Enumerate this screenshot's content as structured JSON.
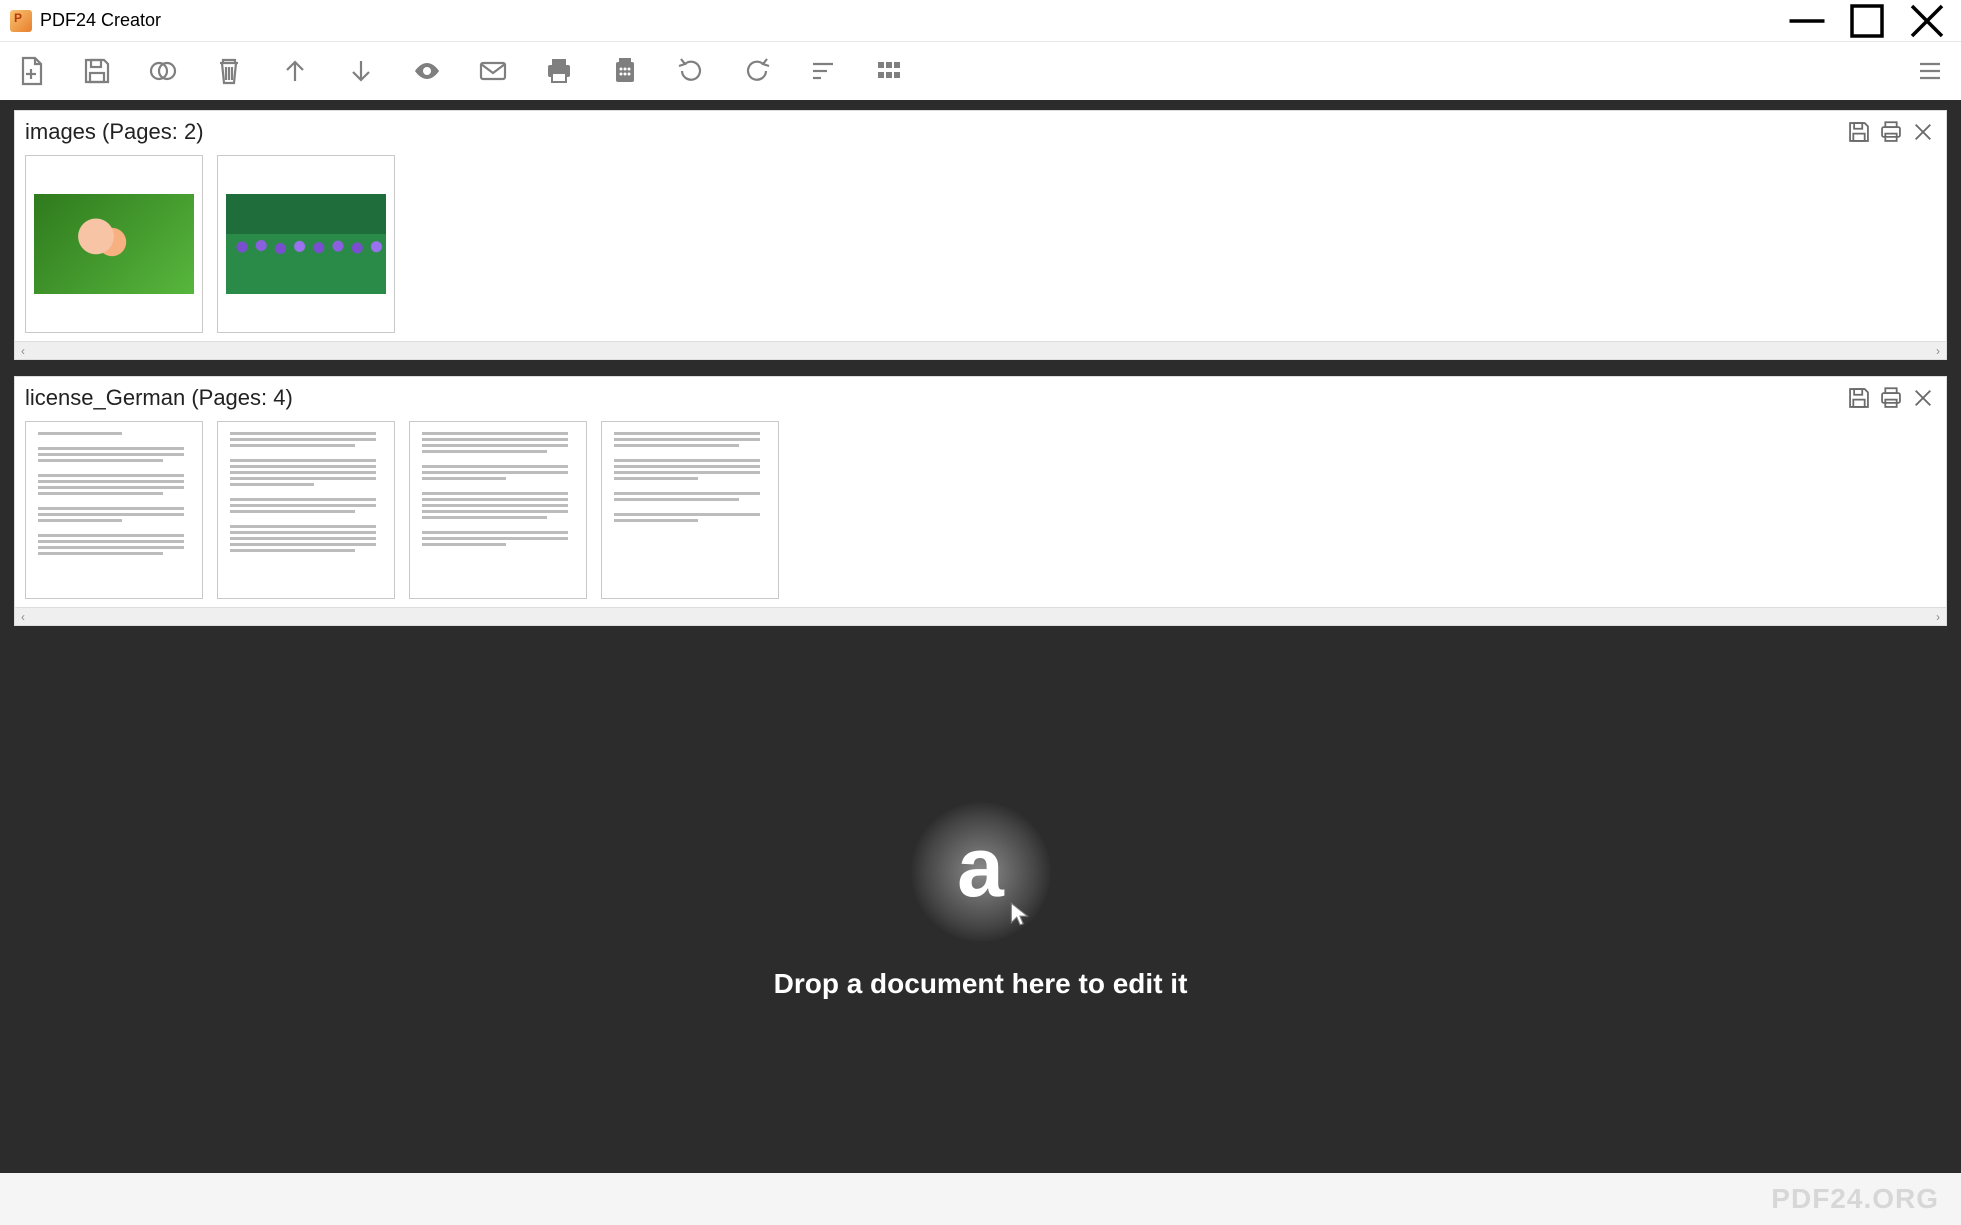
{
  "window": {
    "title": "PDF24 Creator"
  },
  "toolbar": {
    "new": "new-file",
    "save": "save",
    "merge": "merge",
    "delete": "delete",
    "up": "move-up",
    "down": "move-down",
    "preview": "preview",
    "email": "email",
    "print": "print",
    "fax": "fax",
    "rotate_left": "rotate-left",
    "rotate_right": "rotate-right",
    "sort": "sort",
    "grid": "grid-view",
    "menu": "menu"
  },
  "documents": [
    {
      "name": "images",
      "pages_label": "(Pages: 2)",
      "page_count": 2,
      "type": "images"
    },
    {
      "name": "license_German",
      "pages_label": "(Pages: 4)",
      "page_count": 4,
      "type": "text"
    }
  ],
  "doc_actions": {
    "save": "save",
    "print": "print",
    "close": "close"
  },
  "dropzone": {
    "hint": "Drop a document here to edit it"
  },
  "footer": {
    "brand": "PDF24.ORG"
  }
}
